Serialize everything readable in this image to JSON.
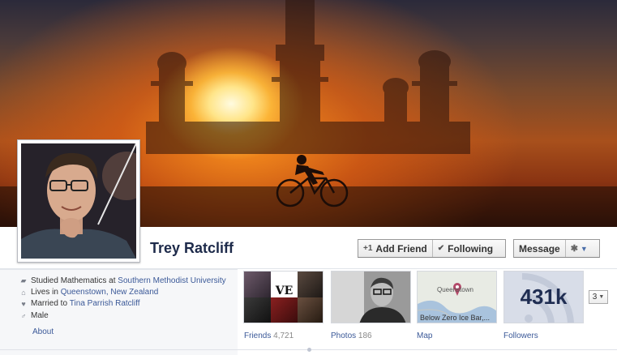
{
  "profile": {
    "name": "Trey Ratcliff"
  },
  "buttons": {
    "add_friend": "Add Friend",
    "following": "Following",
    "message": "Message",
    "add_friend_icon": "+1",
    "following_icon": "✔"
  },
  "info": {
    "education_prefix": "Studied Mathematics at",
    "education_link": "Southern Methodist University",
    "location_prefix": "Lives in",
    "location_link": "Queenstown, New Zealand",
    "relationship_prefix": "Married to",
    "relationship_link": "Tina Parrish Ratcliff",
    "gender": "Male",
    "about": "About"
  },
  "thumbs": {
    "friends_label": "Friends",
    "friends_count": "4,721",
    "photos_label": "Photos",
    "photos_count": "186",
    "map_label": "Map",
    "map_place": "Queenstown",
    "map_pin_label": "Below Zero Ice Bar,...",
    "followers_label": "Followers",
    "followers_count": "431k",
    "friends_tile_text": "VE"
  },
  "more": {
    "value": "3"
  },
  "icons": {
    "education": "graduation-cap-icon",
    "location": "house-icon",
    "relationship": "heart-icon",
    "gender": "male-icon",
    "gear": "gear-icon",
    "caret": "chevron-down-icon"
  },
  "colors": {
    "link": "#3b5998",
    "name": "#1d2a4a"
  }
}
